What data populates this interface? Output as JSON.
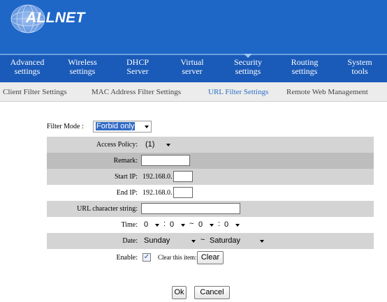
{
  "brand": {
    "logo_text": "ALLNET"
  },
  "main_nav": [
    {
      "label_1": "Advanced",
      "label_2": "settings"
    },
    {
      "label_1": "Wireless",
      "label_2": "settings"
    },
    {
      "label_1": "DHCP",
      "label_2": "Server"
    },
    {
      "label_1": "Virtual",
      "label_2": "server"
    },
    {
      "label_1": "Security",
      "label_2": "settings",
      "active": true
    },
    {
      "label_1": "Routing",
      "label_2": "settings"
    },
    {
      "label_1": "System",
      "label_2": "tools"
    }
  ],
  "sub_nav": [
    {
      "label": "Client Filter Settings"
    },
    {
      "label": "MAC Address Filter Settings"
    },
    {
      "label": "URL Filter Settings",
      "active": true
    },
    {
      "label": "Remote Web Management"
    }
  ],
  "form": {
    "filter_mode_label": "Filter Mode :",
    "filter_mode_value": "Forbid only",
    "access_policy_label": "Access Policy:",
    "access_policy_value": "(1)",
    "remark_label": "Remark:",
    "remark_value": "",
    "start_ip_label": "Start IP:",
    "start_ip_prefix": "192.168.0.",
    "start_ip_value": "",
    "end_ip_label": "End IP:",
    "end_ip_prefix": "192.168.0.",
    "end_ip_value": "",
    "url_label": "URL character string:",
    "url_value": "",
    "time_label": "Time:",
    "time_start_hour": "0",
    "time_start_min": "0",
    "time_end_hour": "0",
    "time_end_min": "0",
    "time_colon": ":",
    "range_sep": "~",
    "date_label": "Date:",
    "date_start": "Sunday",
    "date_end": "Saturday",
    "enable_label": "Enable:",
    "enable_checked": true,
    "clear_item_label": "Clear this item:",
    "clear_button": "Clear",
    "ok_button": "Ok",
    "cancel_button": "Cancel"
  },
  "colors": {
    "header_blue": "#1f67c7",
    "nav_blue": "#1a5ab8",
    "active_subnav": "#2a70c8",
    "row_gray": "#d4d4d4"
  }
}
